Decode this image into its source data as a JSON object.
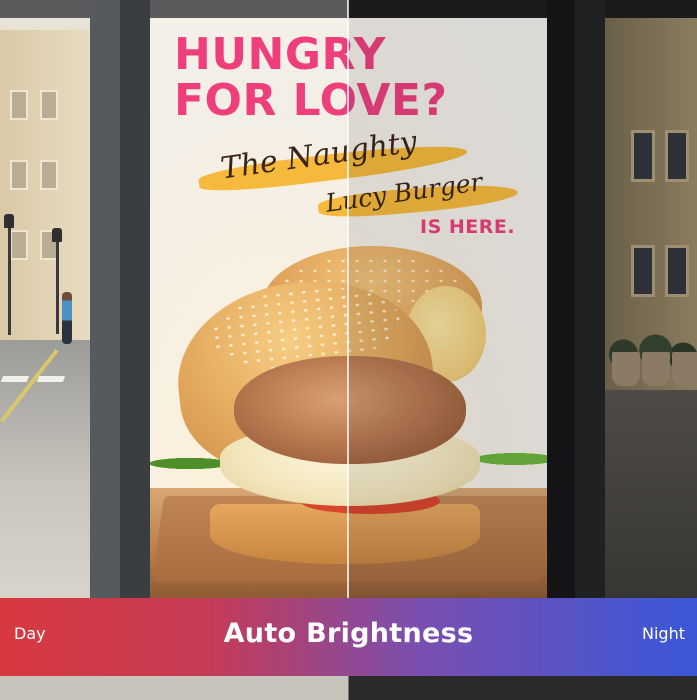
{
  "poster": {
    "headline_line1": "HUNGRY",
    "headline_line2": "FOR LOVE?",
    "script_line1": "The Naughty",
    "script_line2": "Lucy Burger",
    "tagline": "IS HERE."
  },
  "brightness_bar": {
    "left_label": "Day",
    "title": "Auto Brightness",
    "right_label": "Night"
  },
  "colors": {
    "headline_pink": "#ee3f7c",
    "brush_yellow": "#f5b531",
    "bar_red": "#d8393f",
    "bar_blue": "#3a57d8"
  }
}
